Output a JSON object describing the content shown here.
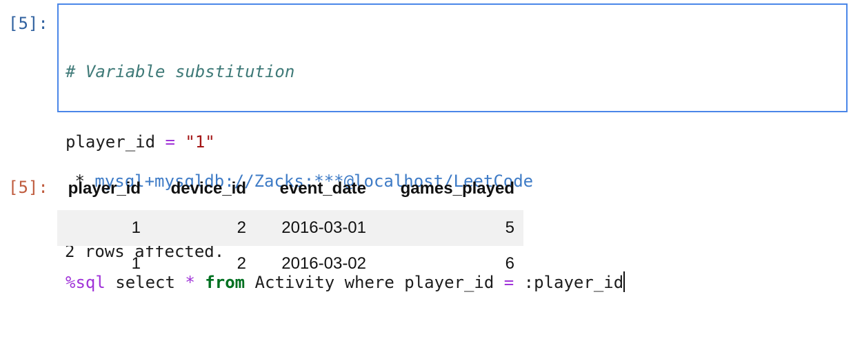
{
  "cell": {
    "in_prompt": "[5]:",
    "out_prompt": "[5]:",
    "code": {
      "comment": "# Variable substitution",
      "line2_var": "player_id",
      "line2_op": "=",
      "line2_str": "\"1\"",
      "line4_magic": "%sql",
      "line4_select": " select ",
      "line4_star": "*",
      "line4_from": "from",
      "line4_rest": " Activity where player_id ",
      "line4_eq": "=",
      "line4_param": " :player_id"
    }
  },
  "stdout": {
    "conn_star": " * ",
    "conn_url": "mysql+mysqldb://Zacks:***@localhost/LeetCode",
    "rows_msg": "2 rows affected."
  },
  "table": {
    "headers": [
      "player_id",
      "device_id",
      "event_date",
      "games_played"
    ],
    "rows": [
      [
        "1",
        "2",
        "2016-03-01",
        "5"
      ],
      [
        "1",
        "2",
        "2016-03-02",
        "6"
      ]
    ]
  }
}
